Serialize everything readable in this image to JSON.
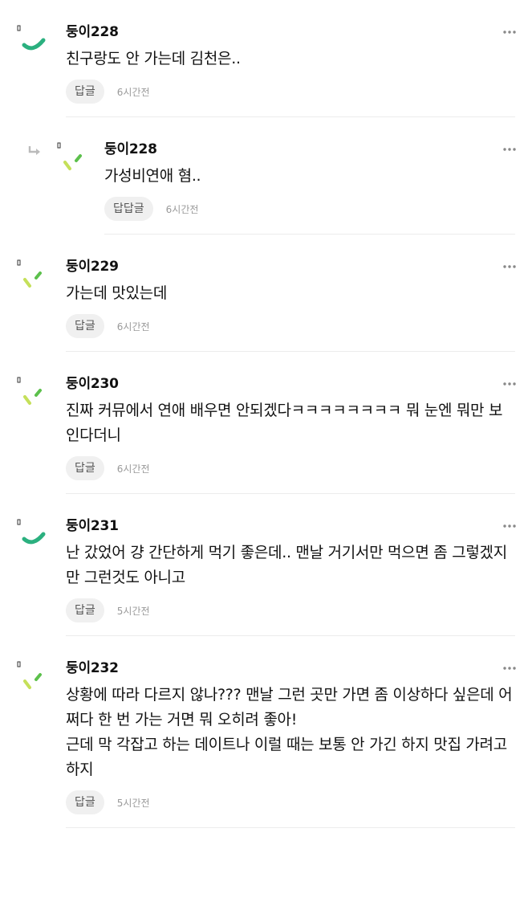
{
  "comments": [
    {
      "nick": "둥이228",
      "text": "친구랑도 안 가는데 김천은..",
      "reply_label": "답글",
      "time": "6시간전",
      "avatar_style": "arc",
      "is_reply": false
    },
    {
      "nick": "둥이228",
      "text": "가성비연애 혐..",
      "reply_label": "답답글",
      "time": "6시간전",
      "avatar_style": "dashes",
      "is_reply": true
    },
    {
      "nick": "둥이229",
      "text": "가는데 맛있는데",
      "reply_label": "답글",
      "time": "6시간전",
      "avatar_style": "dashes",
      "is_reply": false
    },
    {
      "nick": "둥이230",
      "text": "진짜 커뮤에서 연애 배우면 안되겠다ㅋㅋㅋㅋㅋㅋㅋㅋ 뭐 눈엔 뭐만 보인다더니",
      "reply_label": "답글",
      "time": "6시간전",
      "avatar_style": "dashes",
      "is_reply": false
    },
    {
      "nick": "둥이231",
      "text": "난 갔었어 걍 간단하게 먹기 좋은데.. 맨날 거기서만 먹으면 좀 그렇겠지만 그런것도 아니고",
      "reply_label": "답글",
      "time": "5시간전",
      "avatar_style": "arc",
      "is_reply": false
    },
    {
      "nick": "둥이232",
      "text": "상황에 따라 다르지 않나??? 맨날 그런 곳만 가면 좀 이상하다 싶은데 어쩌다 한 번 가는 거면 뭐 오히려 좋아!\n근데 막 각잡고 하는 데이트나 이럴 때는 보통 안 가긴 하지 맛집 가려고 하지",
      "reply_label": "답글",
      "time": "5시간전",
      "avatar_style": "dashes",
      "is_reply": false
    }
  ],
  "colors": {
    "arc": "#2bb07f",
    "dash_light": "#c5e05a",
    "dash_dark": "#5cc04c"
  }
}
